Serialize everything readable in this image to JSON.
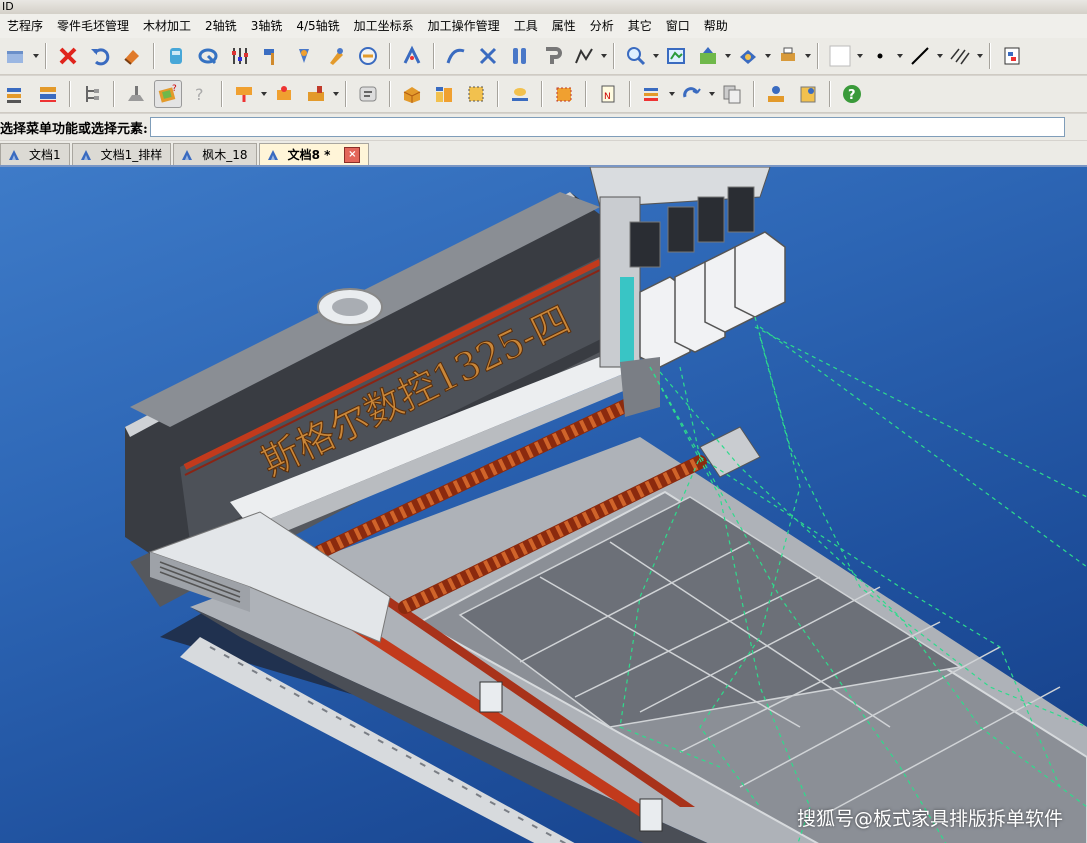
{
  "window": {
    "title": "ID"
  },
  "menu": [
    "艺程序",
    "零件毛坯管理",
    "木材加工",
    "2轴铣",
    "3轴铣",
    "4/5轴铣",
    "加工坐标系",
    "加工操作管理",
    "工具",
    "属性",
    "分析",
    "其它",
    "窗口",
    "帮助"
  ],
  "command_line": {
    "label": "选择菜单功能或选择元素:",
    "value": ""
  },
  "tabs": [
    {
      "label": "文档1",
      "active": false
    },
    {
      "label": "文档1_排样",
      "active": false
    },
    {
      "label": "枫木_18",
      "active": false
    },
    {
      "label": "文档8 *",
      "active": true
    }
  ],
  "tab_close_glyph": "×",
  "machine_label": "斯格尔数控1325-四",
  "watermark": "搜狐号@板式家具排版拆单软件",
  "toolbar1_icons": [
    "open-icon",
    "delete-icon",
    "undo-icon",
    "eraser-icon",
    "layer-icon",
    "measure-icon",
    "sliders-icon",
    "hammer-icon",
    "spindle-icon",
    "tool-icon",
    "clock-icon",
    "pick-icon",
    "cut-icon",
    "parallel-icon",
    "magnet-icon",
    "curve-icon",
    "zoom-icon",
    "fit-view-icon",
    "export-icon",
    "view-direction-icon",
    "print-icon",
    "color-icon",
    "point-icon",
    "line-style-icon",
    "hatch-icon",
    "properties-icon"
  ],
  "toolbar2_icons": [
    "stack-icon",
    "stack-alt-icon",
    "tree-icon",
    "plane-icon",
    "help-cursor-icon",
    "hint-icon",
    "drill-icon",
    "drill-alt-icon",
    "machine-icon",
    "text-box-icon",
    "box-icon",
    "nest-icon",
    "frame-icon",
    "path-icon",
    "edge-icon",
    "note-icon",
    "layers-icon",
    "tool-change-icon",
    "copy-icon",
    "user-icon",
    "report-icon",
    "help-icon"
  ],
  "colors": {
    "viewport": "#2d66b5",
    "toolpath": "#2ddc8c",
    "rail": "#c23a1c",
    "tab_active": "#fff5d8"
  }
}
